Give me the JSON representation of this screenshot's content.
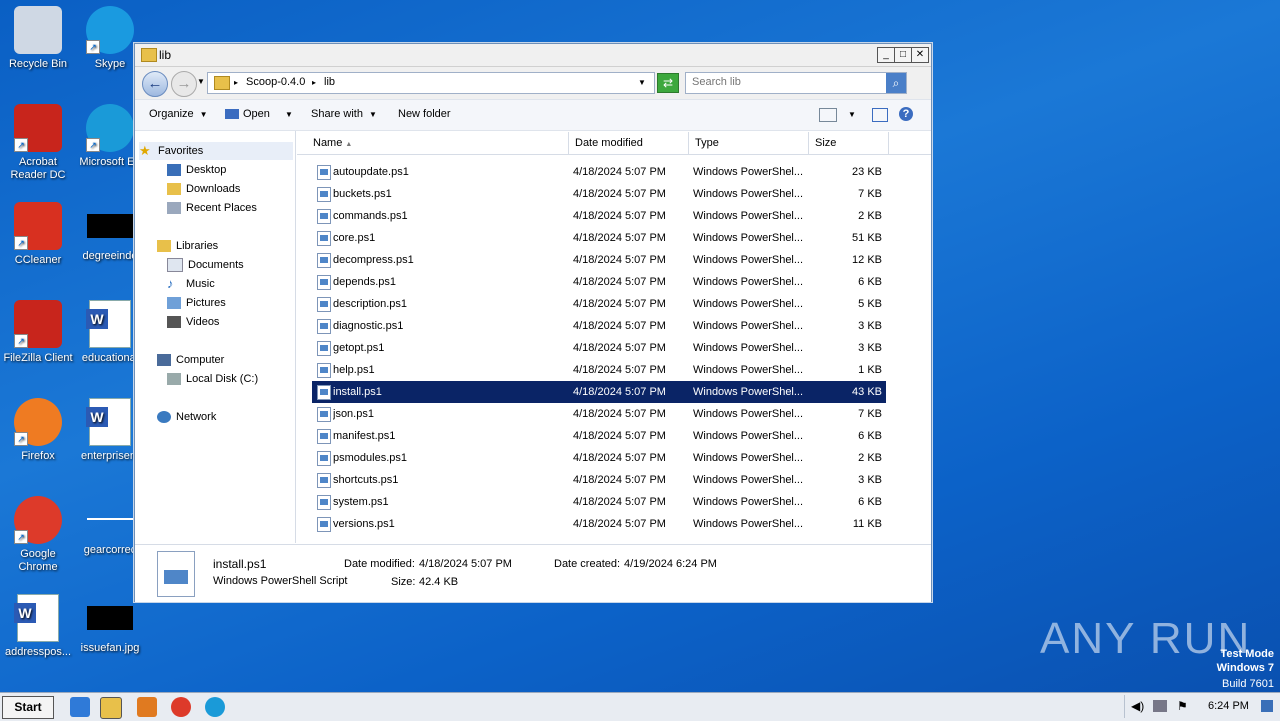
{
  "desktop": {
    "icons": [
      {
        "label": "Recycle Bin"
      },
      {
        "label": "Skype"
      },
      {
        "label": "Acrobat\nReader DC"
      },
      {
        "label": "Microsoft Ed"
      },
      {
        "label": "CCleaner"
      },
      {
        "label": "degreeinde"
      },
      {
        "label": "FileZilla Client"
      },
      {
        "label": "educational"
      },
      {
        "label": "Firefox"
      },
      {
        "label": "enterprisem"
      },
      {
        "label": "Google\nChrome"
      },
      {
        "label": "gearcorrec"
      },
      {
        "label": "addresspos..."
      },
      {
        "label": "issuefan.jpg"
      }
    ]
  },
  "window": {
    "title": "lib",
    "breadcrumb": [
      "Scoop-0.4.0",
      "lib"
    ],
    "search_placeholder": "Search lib",
    "toolbar": {
      "organize": "Organize",
      "open": "Open",
      "share_with": "Share with",
      "new_folder": "New folder"
    },
    "nav": {
      "favorites": "Favorites",
      "desktop": "Desktop",
      "downloads": "Downloads",
      "recent_places": "Recent Places",
      "libraries": "Libraries",
      "documents": "Documents",
      "music": "Music",
      "pictures": "Pictures",
      "videos": "Videos",
      "computer": "Computer",
      "local_disk": "Local Disk (C:)",
      "network": "Network"
    },
    "columns": {
      "name": "Name",
      "date": "Date modified",
      "type": "Type",
      "size": "Size"
    },
    "files": [
      {
        "name": "autoupdate.ps1",
        "date": "4/18/2024 5:07 PM",
        "type": "Windows PowerShel...",
        "size": "23 KB"
      },
      {
        "name": "buckets.ps1",
        "date": "4/18/2024 5:07 PM",
        "type": "Windows PowerShel...",
        "size": "7 KB"
      },
      {
        "name": "commands.ps1",
        "date": "4/18/2024 5:07 PM",
        "type": "Windows PowerShel...",
        "size": "2 KB"
      },
      {
        "name": "core.ps1",
        "date": "4/18/2024 5:07 PM",
        "type": "Windows PowerShel...",
        "size": "51 KB"
      },
      {
        "name": "decompress.ps1",
        "date": "4/18/2024 5:07 PM",
        "type": "Windows PowerShel...",
        "size": "12 KB"
      },
      {
        "name": "depends.ps1",
        "date": "4/18/2024 5:07 PM",
        "type": "Windows PowerShel...",
        "size": "6 KB"
      },
      {
        "name": "description.ps1",
        "date": "4/18/2024 5:07 PM",
        "type": "Windows PowerShel...",
        "size": "5 KB"
      },
      {
        "name": "diagnostic.ps1",
        "date": "4/18/2024 5:07 PM",
        "type": "Windows PowerShel...",
        "size": "3 KB"
      },
      {
        "name": "getopt.ps1",
        "date": "4/18/2024 5:07 PM",
        "type": "Windows PowerShel...",
        "size": "3 KB"
      },
      {
        "name": "help.ps1",
        "date": "4/18/2024 5:07 PM",
        "type": "Windows PowerShel...",
        "size": "1 KB"
      },
      {
        "name": "install.ps1",
        "date": "4/18/2024 5:07 PM",
        "type": "Windows PowerShel...",
        "size": "43 KB"
      },
      {
        "name": "json.ps1",
        "date": "4/18/2024 5:07 PM",
        "type": "Windows PowerShel...",
        "size": "7 KB"
      },
      {
        "name": "manifest.ps1",
        "date": "4/18/2024 5:07 PM",
        "type": "Windows PowerShel...",
        "size": "6 KB"
      },
      {
        "name": "psmodules.ps1",
        "date": "4/18/2024 5:07 PM",
        "type": "Windows PowerShel...",
        "size": "2 KB"
      },
      {
        "name": "shortcuts.ps1",
        "date": "4/18/2024 5:07 PM",
        "type": "Windows PowerShel...",
        "size": "3 KB"
      },
      {
        "name": "system.ps1",
        "date": "4/18/2024 5:07 PM",
        "type": "Windows PowerShel...",
        "size": "6 KB"
      },
      {
        "name": "versions.ps1",
        "date": "4/18/2024 5:07 PM",
        "type": "Windows PowerShel...",
        "size": "11 KB"
      }
    ],
    "selected_file": "install.ps1",
    "details": {
      "name": "install.ps1",
      "type": "Windows PowerShell Script",
      "date_modified_label": "Date modified:",
      "date_modified": "4/18/2024 5:07 PM",
      "date_created_label": "Date created:",
      "date_created": "4/19/2024 6:24 PM",
      "size_label": "Size:",
      "size": "42.4 KB"
    }
  },
  "taskbar": {
    "start": "Start",
    "clock": "6:24 PM"
  },
  "watermark": {
    "text": "ANY RUN"
  },
  "test_mode": {
    "line1": "Test Mode",
    "line2": "Windows 7",
    "line3": "Build 7601"
  },
  "colors": {
    "selection": "#0a2466",
    "desktop": "#1b78d6"
  }
}
